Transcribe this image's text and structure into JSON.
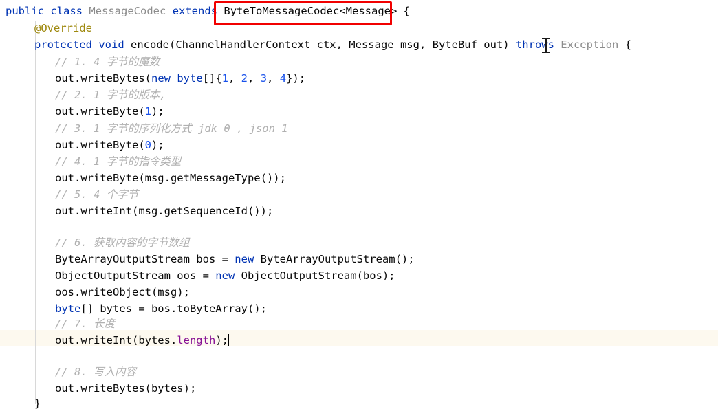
{
  "editor": {
    "language": "Java",
    "background_color": "#ffffff",
    "current_line_color": "#fdf9ef",
    "annotation_box_color": "#f10000",
    "theme_colors": {
      "keyword": "#0033b3",
      "number": "#1750eb",
      "class_name": "#8c8c8c",
      "comment": "#b0b0b0",
      "annotation": "#9e880d",
      "field": "#871094",
      "plain": "#080808"
    }
  },
  "code": {
    "line_1": {
      "kw_public": "public",
      "kw_class": "class",
      "class_name": "MessageCodec",
      "kw_extends": "extends",
      "super_type": "ByteToMessageCodec<Message>",
      "brace": "{"
    },
    "line_2": {
      "annotation": "@Override"
    },
    "line_3": {
      "kw_protected": "protected",
      "kw_void": "void",
      "method": "encode",
      "params": "(ChannelHandlerContext ctx, Message msg, ByteBuf out)",
      "kw_throws": "throws",
      "exception": "Exception",
      "brace": "{"
    },
    "line_4": {
      "comment": "// 1. 4 字节的魔数"
    },
    "line_5": {
      "pre": "out.writeBytes(",
      "kw_new": "new",
      "kw_byte": "byte",
      "brackets": "[]{",
      "n1": "1",
      "c1": ", ",
      "n2": "2",
      "c2": ", ",
      "n3": "3",
      "c3": ", ",
      "n4": "4",
      "post": "});"
    },
    "line_6": {
      "comment": "// 2. 1 字节的版本,"
    },
    "line_7": {
      "pre": "out.writeByte(",
      "num": "1",
      "post": ");"
    },
    "line_8": {
      "comment": "// 3. 1 字节的序列化方式 jdk 0 , json 1"
    },
    "line_9": {
      "pre": "out.writeByte(",
      "num": "0",
      "post": ");"
    },
    "line_10": {
      "comment": "// 4. 1 字节的指令类型"
    },
    "line_11": {
      "text": "out.writeByte(msg.getMessageType());"
    },
    "line_12": {
      "comment": "// 5. 4 个字节"
    },
    "line_13": {
      "text": "out.writeInt(msg.getSequenceId());"
    },
    "line_14": {
      "text": ""
    },
    "line_15": {
      "comment": "// 6. 获取内容的字节数组"
    },
    "line_16": {
      "pre": "ByteArrayOutputStream bos = ",
      "kw_new": "new",
      "post": " ByteArrayOutputStream();"
    },
    "line_17": {
      "pre": "ObjectOutputStream oos = ",
      "kw_new": "new",
      "post": " ObjectOutputStream(bos);"
    },
    "line_18": {
      "text": "oos.writeObject(msg);"
    },
    "line_19": {
      "kw_byte": "byte",
      "post": "[] bytes = bos.toByteArray();"
    },
    "line_20": {
      "comment": "// 7. 长度"
    },
    "line_21": {
      "pre": "out.writeInt(bytes.",
      "field": "length",
      "post": ");"
    },
    "line_22": {
      "text": ""
    },
    "line_23": {
      "comment": "// 8. 写入内容"
    },
    "line_24": {
      "text": "out.writeBytes(bytes);"
    },
    "line_25": {
      "text": "}"
    }
  }
}
